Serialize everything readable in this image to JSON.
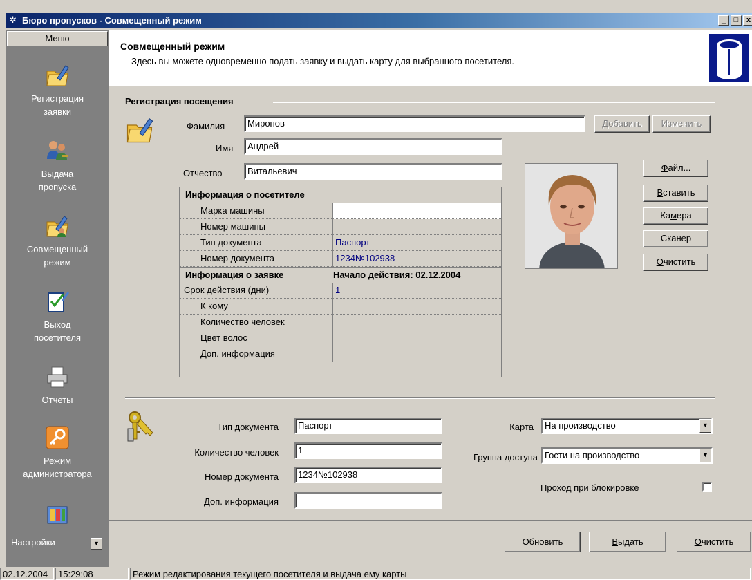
{
  "window": {
    "title": "Бюро пропусков - Совмещенный режим",
    "controls": [
      "_",
      "□",
      "x"
    ]
  },
  "sidebar": {
    "menu_label": "Меню",
    "items": [
      {
        "label": "Регистрация\nзаявки",
        "icon": "folder-pen-icon"
      },
      {
        "label": "Выдача\nпропуска",
        "icon": "users-key-icon"
      },
      {
        "label": "Совмещенный\nрежим",
        "icon": "folder-user-icon"
      },
      {
        "label": "Выход\nпосетителя",
        "icon": "checklist-icon"
      },
      {
        "label": "Отчеты",
        "icon": "printer-icon"
      },
      {
        "label": "Режим\nадминистратора",
        "icon": "key-icon"
      },
      {
        "label": "Настройки",
        "icon": "settings-icon"
      }
    ]
  },
  "header": {
    "title": "Совмещенный режим",
    "subtitle": "Здесь вы можете одновременно подать заявку и выдать карту для выбранного посетителя."
  },
  "registration": {
    "group_title": "Регистрация посещения",
    "surname_label": "Фамилия",
    "surname_value": "Миронов",
    "name_label": "Имя",
    "name_value": "Андрей",
    "patronymic_label": "Отчество",
    "patronymic_value": "Витальевич",
    "add_button": "Добавить",
    "edit_button": "Изменить"
  },
  "photo_buttons": {
    "file": "Файл...",
    "paste": "Вставить",
    "camera": "Камера",
    "scanner": "Сканер",
    "clear": "Очистить"
  },
  "visitor_info": {
    "header": "Информация о посетителе",
    "rows": [
      {
        "label": "Марка машины",
        "value": ""
      },
      {
        "label": "Номер машины",
        "value": ""
      },
      {
        "label": "Тип документа",
        "value": "Паспорт"
      },
      {
        "label": "Номер документа",
        "value": "1234№102938"
      }
    ]
  },
  "request_info": {
    "header": "Информация о заявке",
    "start_label": "Начало действия: 02.12.2004",
    "rows": [
      {
        "label": "Срок действия (дни)",
        "value": "1"
      },
      {
        "label": "К кому",
        "value": ""
      },
      {
        "label": "Количество человек",
        "value": ""
      },
      {
        "label": "Цвет волос",
        "value": ""
      },
      {
        "label": "Доп. информация",
        "value": ""
      }
    ]
  },
  "issue": {
    "doc_type_label": "Тип документа",
    "doc_type_value": "Паспорт",
    "people_count_label": "Количество человек",
    "people_count_value": "1",
    "doc_number_label": "Номер документа",
    "doc_number_value": "1234№102938",
    "extra_info_label": "Доп. информация",
    "extra_info_value": "",
    "card_label": "Карта",
    "card_value": "На производство",
    "access_group_label": "Группа доступа",
    "access_group_value": "Гости на производство",
    "block_pass_label": "Проход при блокировке",
    "block_pass_checked": false
  },
  "actions": {
    "refresh": "Обновить",
    "issue": "Выдать",
    "clear": "Очистить"
  },
  "status": {
    "date": "02.12.2004",
    "time": "15:29:08",
    "message": "Режим редактирования текущего посетителя и выдача ему карты"
  }
}
